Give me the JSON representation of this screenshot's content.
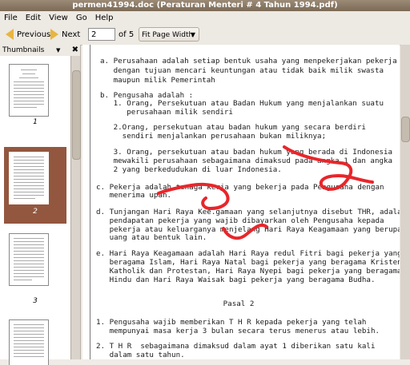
{
  "window": {
    "title": "permen41994.doc (Peraturan Menteri # 4 Tahun 1994.pdf)"
  },
  "menu": [
    "File",
    "Edit",
    "View",
    "Go",
    "Help"
  ],
  "toolbar": {
    "previous": "Previous",
    "next": "Next",
    "page_value": "2",
    "page_of": "of 5",
    "zoom": "Fit Page Width"
  },
  "sidebar": {
    "title": "Thumbnails",
    "thumbnails": [
      {
        "label": "1"
      },
      {
        "label": "2"
      },
      {
        "label": "3"
      }
    ]
  },
  "document": {
    "lines": [
      "a. Perusahaan adalah setiap bentuk usaha yang menpekerjakan pekerja",
      "   dengan tujuan mencari keuntungan atau tidak baik milik swasta",
      "   maupun milik Pemerintah",
      "b. Pengusaha adalah :",
      "   1. Orang, Persekutuan atau Badan Hukum yang menjalankan suatu",
      "      perusahaan milik sendiri",
      "   2.Orang, persekutuan atau badan hukum yang secara berdiri",
      "     sendiri menjalankan perusahaan bukan miliknya;",
      "   3. Orang, persekutuan atau badan hukum yang berada di Indonesia",
      "   mewakili perusahaan sebagaimana dimaksud pada angka 1 dan angka",
      "   2 yang berkedudukan di luar Indonesia.",
      "c. Pekerja adalah tenaga kerja yang bekerja pada Pengusaha dengan",
      "   menerima upah.",
      "d. Tunjangan Hari Raya Kee.gamaan yang selanjutnya disebut THR, adalah",
      "   pendapatan pekerja yang wajib dibayarkan oleh Pengusaha kepada",
      "   pekerja atau keluarganya menjelang Hari Raya Keagamaan yang berupa",
      "   uang atau bentuk lain.",
      "e. Hari Raya Keagamaan adalah Hari Raya redul Fitri bagi pekerja yang",
      "   beragama Islam, Hari Raya Natal bagi pekerja yang beragama Kristen",
      "   Katholik dan Protestan, Hari Raya Nyepi bagi pekerja yang beragama",
      "   Hindu dan Hari Raya Waisak bagi pekerja yang beragama Budha.",
      "Pasal 2",
      "1. Pengusaha wajib memberikan T H R kepada pekerja yang telah",
      "   mempunyai masa kerja 3 bulan secara terus menerus atau lebih.",
      "2. T H R  sebagaimana dimaksud dalam ayat 1 diberikan satu kali",
      "   dalam satu tahun."
    ]
  },
  "colors": {
    "annotation": "#e8262b",
    "selected_thumbnail": "#93573f",
    "arrow": "#e7b640"
  }
}
